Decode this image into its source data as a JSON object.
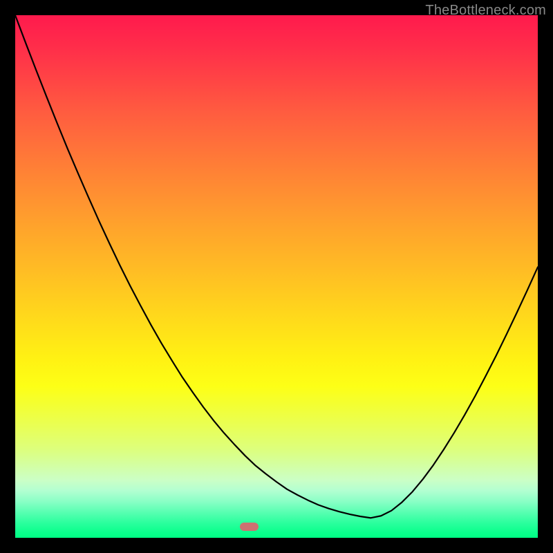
{
  "watermark": "TheBottleneck.com",
  "chart_data": {
    "type": "line",
    "title": "",
    "xlabel": "",
    "ylabel": "",
    "xlim": [
      0,
      100
    ],
    "ylim": [
      0,
      100
    ],
    "grid": false,
    "x": [
      0,
      2,
      4,
      6,
      8,
      10,
      12,
      14,
      16,
      18,
      20,
      22,
      24,
      26,
      28,
      30,
      32,
      34,
      36,
      38,
      40,
      42,
      44,
      46,
      48,
      50,
      52,
      54,
      56,
      58,
      60,
      62,
      64,
      66,
      68,
      70,
      72,
      74,
      76,
      78,
      80,
      82,
      84,
      86,
      88,
      90,
      92,
      94,
      96,
      98,
      100
    ],
    "values": [
      100.0,
      94.7,
      89.5,
      84.4,
      79.4,
      74.5,
      69.8,
      65.2,
      60.7,
      56.4,
      52.2,
      48.2,
      44.4,
      40.7,
      37.2,
      33.9,
      30.7,
      27.8,
      25.0,
      22.4,
      20.0,
      17.8,
      15.7,
      13.8,
      12.2,
      10.7,
      9.3,
      8.2,
      7.2,
      6.3,
      5.6,
      5.0,
      4.5,
      4.1,
      3.8,
      4.2,
      5.2,
      6.8,
      8.8,
      11.2,
      13.9,
      16.9,
      20.1,
      23.5,
      27.1,
      30.9,
      34.8,
      38.9,
      43.1,
      47.4,
      51.8
    ],
    "marker": {
      "x": 44.5,
      "y": 2.0,
      "w": 3.6,
      "h": 1.6,
      "color": "#cd7171"
    },
    "background": "vertical-gradient-red-to-green"
  },
  "marker_style": {
    "left_pct": 43.0,
    "top_pct": 97.1,
    "width_pct": 3.6,
    "height_pct": 1.6
  }
}
